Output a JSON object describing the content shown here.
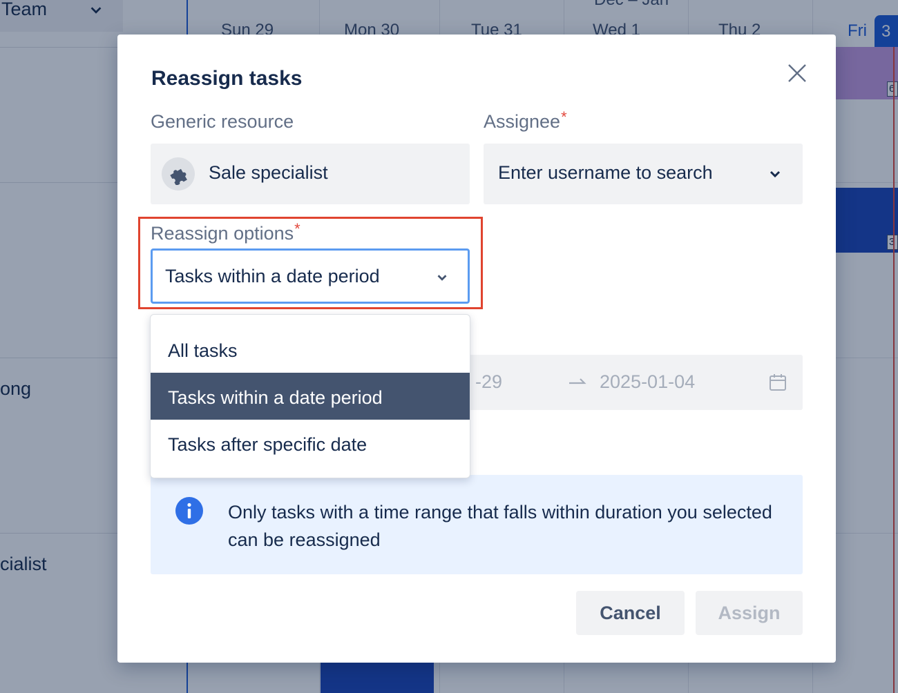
{
  "background": {
    "team_select_label": "Team",
    "month_range": "Dec – Jan",
    "days": [
      "Sun  29",
      "Mon  30",
      "Tue  31",
      "Wed  1",
      "Thu  2"
    ],
    "today_day": "Fri",
    "today_date": "3",
    "row_labels": [
      "ong",
      "cialist"
    ],
    "bar_counts": [
      "6",
      "3"
    ]
  },
  "modal": {
    "title": "Reassign tasks",
    "generic_resource_label": "Generic resource",
    "generic_resource_value": "Sale specialist",
    "assignee_label": "Assignee",
    "assignee_placeholder": "Enter username to search",
    "reassign_options_label": "Reassign options",
    "reassign_options_value": "Tasks within a date period",
    "required_marker": "*",
    "date_range": {
      "start": "-29",
      "end": "2025-01-04"
    },
    "dropdown_options": [
      "All tasks",
      "Tasks within a date period",
      "Tasks after specific date"
    ],
    "dropdown_selected_index": 1,
    "info_text": "Only tasks with a time range that falls within duration you selected can be reassigned",
    "cancel_label": "Cancel",
    "assign_label": "Assign"
  },
  "colors": {
    "primary": "#1d5bd6",
    "highlight": "#e0442f",
    "selected_option": "#44546f",
    "info_bg": "#e9f2ff"
  }
}
